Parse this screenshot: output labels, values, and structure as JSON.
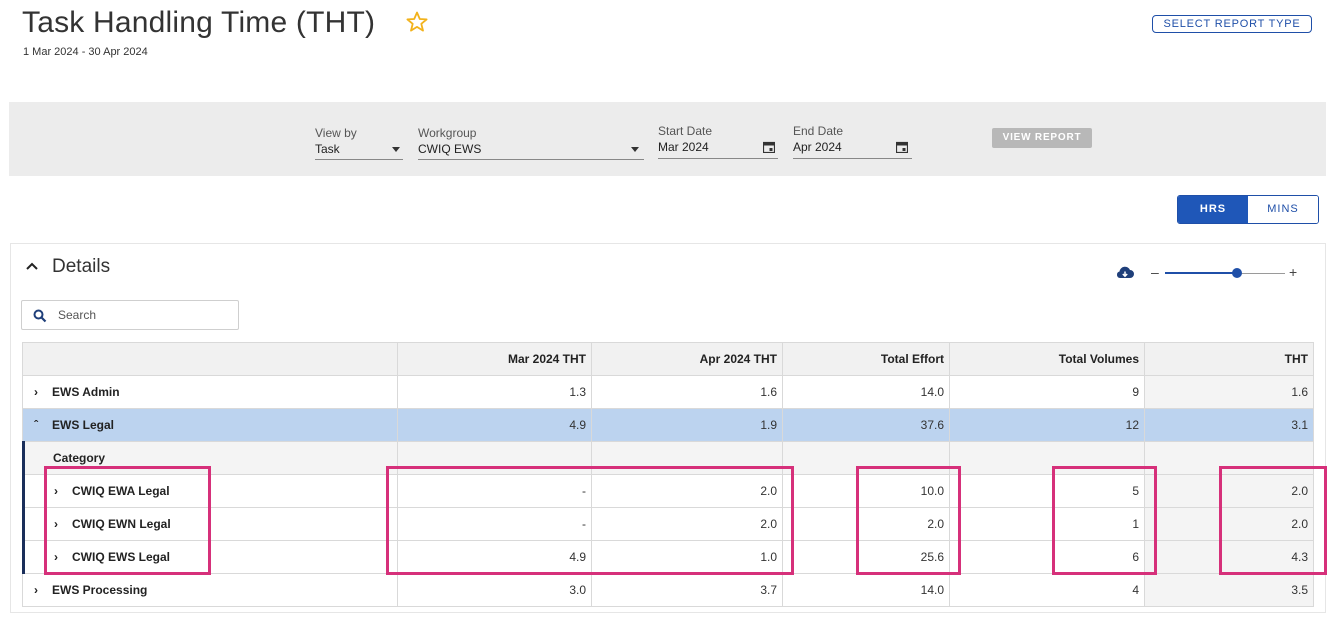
{
  "page": {
    "title": "Task Handling Time (THT)",
    "date_range": "1 Mar 2024 - 30 Apr 2024",
    "select_report_type_label": "SELECT REPORT TYPE"
  },
  "filters": {
    "view_by_label": "View by",
    "view_by_value": "Task",
    "workgroup_label": "Workgroup",
    "workgroup_value": "CWIQ EWS",
    "start_date_label": "Start Date",
    "start_date_value": "Mar 2024",
    "end_date_label": "End Date",
    "end_date_value": "Apr 2024",
    "view_report_label": "VIEW REPORT"
  },
  "units_toggle": {
    "hrs": "HRS",
    "mins": "MINS",
    "selected": "HRS"
  },
  "details": {
    "title": "Details",
    "search_placeholder": "Search",
    "zoom_level": 0.6
  },
  "table": {
    "columns": [
      "",
      "Mar 2024 THT",
      "Apr 2024 THT",
      "Total Effort",
      "Total Volumes",
      "THT"
    ],
    "rows": [
      {
        "name": "EWS Admin",
        "expanded": false,
        "values": [
          "1.3",
          "1.6",
          "14.0",
          "9",
          "1.6"
        ]
      },
      {
        "name": "EWS Legal",
        "expanded": true,
        "values": [
          "4.9",
          "1.9",
          "37.6",
          "12",
          "3.1"
        ]
      },
      {
        "subheader": "Category"
      },
      {
        "name": "CWIQ EWA Legal",
        "child": true,
        "values": [
          "-",
          "2.0",
          "10.0",
          "5",
          "2.0"
        ]
      },
      {
        "name": "CWIQ EWN Legal",
        "child": true,
        "values": [
          "-",
          "2.0",
          "2.0",
          "1",
          "2.0"
        ]
      },
      {
        "name": "CWIQ EWS Legal",
        "child": true,
        "values": [
          "4.9",
          "1.0",
          "25.6",
          "6",
          "4.3"
        ]
      },
      {
        "name": "EWS Processing",
        "expanded": false,
        "values": [
          "3.0",
          "3.7",
          "14.0",
          "4",
          "3.5"
        ]
      }
    ]
  },
  "colors": {
    "accent": "#1f57b8",
    "highlight_row": "#bcd3ef",
    "annotation": "#d6307a",
    "star": "#f2b21b"
  }
}
